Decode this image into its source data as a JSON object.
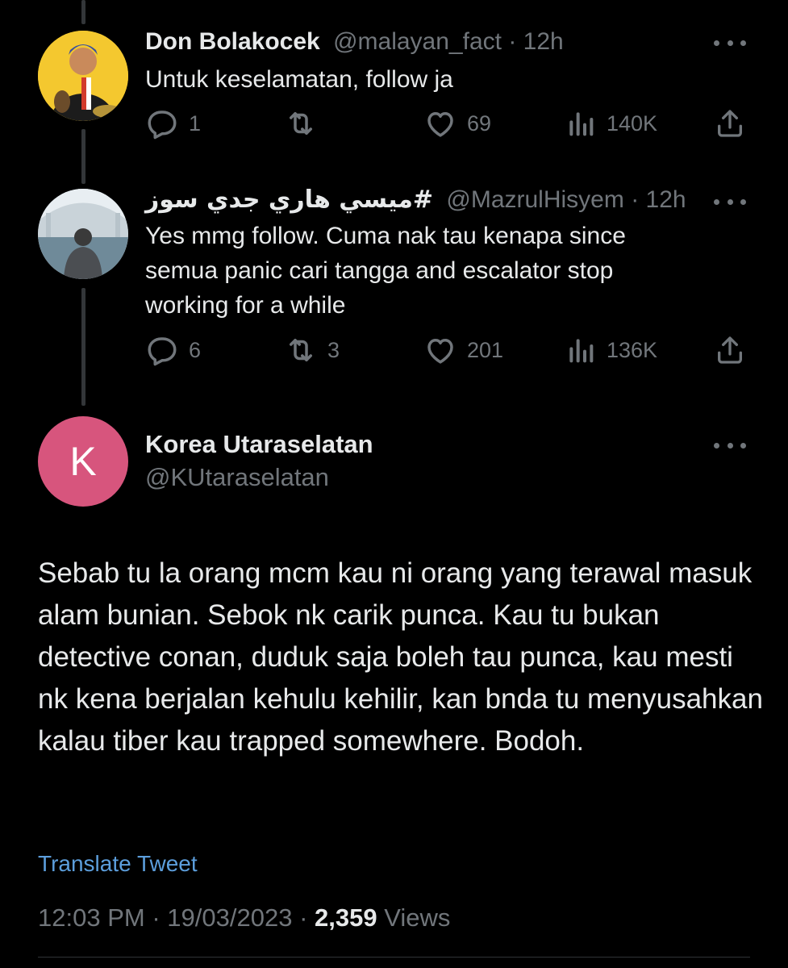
{
  "replies": [
    {
      "display_name": "Don Bolakocek",
      "handle": "@malayan_fact",
      "separator": "·",
      "time": "12h",
      "text": "Untuk keselamatan, follow ja",
      "reply_count": "1",
      "retweet_count": "",
      "like_count": "69",
      "view_count": "140K"
    },
    {
      "display_name": "#ميسي هاري جدي سوز",
      "handle": "@MazrulHisyem",
      "separator": "·",
      "time": "12h",
      "text": "Yes mmg follow. Cuma nak tau kenapa since semua panic cari tangga and escalator stop working for a while",
      "reply_count": "6",
      "retweet_count": "3",
      "like_count": "201",
      "view_count": "136K"
    }
  ],
  "main_tweet": {
    "avatar_letter": "K",
    "display_name": "Korea Utaraselatan",
    "handle": "@KUtaraselatan",
    "text": "Sebab tu la orang mcm kau ni orang yang terawal masuk alam bunian. Sebok nk carik punca. Kau tu bukan detective conan, duduk saja boleh tau punca, kau mesti nk kena berjalan kehulu kehilir, kan bnda tu menyusahkan kalau tiber kau trapped somewhere. Bodoh.",
    "translate_label": "Translate Tweet",
    "time": "12:03 PM",
    "separator": "·",
    "date": "19/03/2023",
    "views_count": "2,359",
    "views_label": "Views"
  },
  "colors": {
    "background": "#000000",
    "text_primary": "#e7e9ea",
    "text_secondary": "#71767b",
    "link": "#5c9edc",
    "avatar_k": "#d7557d",
    "thread_line": "#333639"
  },
  "icons": [
    "reply-icon",
    "retweet-icon",
    "like-icon",
    "views-icon",
    "share-icon",
    "more-icon"
  ]
}
